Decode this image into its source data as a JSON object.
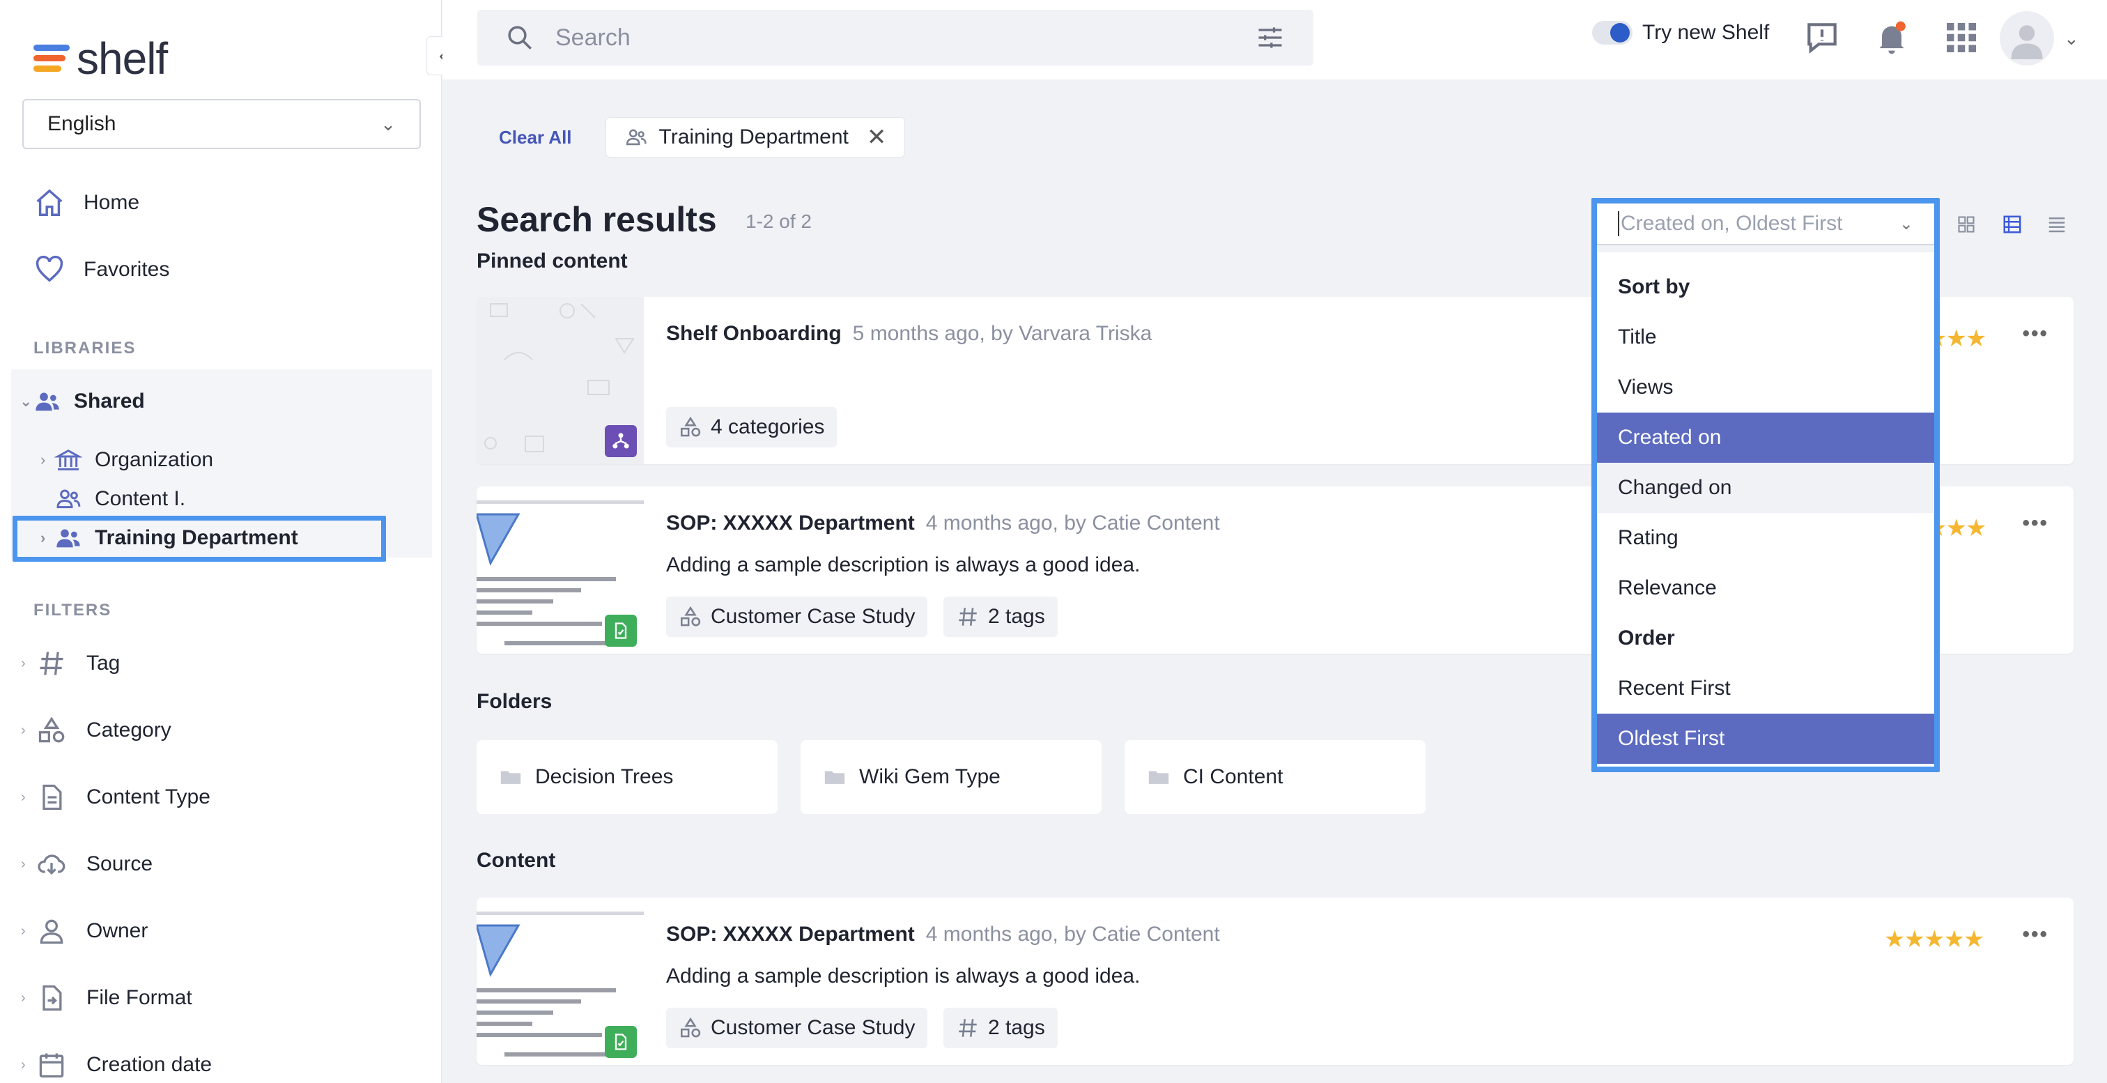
{
  "app": {
    "brand": "shelf",
    "colors": {
      "accent": "#5c6bc0",
      "highlight": "#4b95ee",
      "star": "#f5b730"
    }
  },
  "sidebar": {
    "language": "English",
    "nav": [
      {
        "label": "Home",
        "icon": "home-icon"
      },
      {
        "label": "Favorites",
        "icon": "heart-icon"
      }
    ],
    "libraries_label": "LIBRARIES",
    "libraries": {
      "shared": "Shared",
      "children": [
        "Organization",
        "Content I.",
        "Training Department"
      ]
    },
    "filters_label": "FILTERS",
    "filters": [
      "Tag",
      "Category",
      "Content Type",
      "Source",
      "Owner",
      "File Format",
      "Creation date"
    ]
  },
  "topbar": {
    "search_placeholder": "Search",
    "try_new": "Try new Shelf"
  },
  "main": {
    "clear_all": "Clear All",
    "active_filter": "Training Department",
    "results_title": "Search results",
    "results_count": "1-2 of 2",
    "pinned_label": "Pinned content",
    "folders_label": "Folders",
    "content_label": "Content",
    "pinned": [
      {
        "title": "Shelf Onboarding",
        "meta": "5 months ago, by Varvara Triska",
        "desc": "",
        "tags": [
          "4 categories"
        ]
      },
      {
        "title": "SOP: XXXXX Department",
        "meta": "4 months ago, by Catie Content",
        "desc": "Adding a sample description is always a good idea.",
        "tags": [
          "Customer Case Study",
          "2 tags"
        ]
      }
    ],
    "folders": [
      "Decision Trees",
      "Wiki Gem Type",
      "CI Content"
    ],
    "content": [
      {
        "title": "SOP: XXXXX Department",
        "meta": "4 months ago, by Catie Content",
        "desc": "Adding a sample description is always a good idea.",
        "tags": [
          "Customer Case Study",
          "2 tags"
        ],
        "rating": 5
      }
    ]
  },
  "sort": {
    "value": "Created on, Oldest First",
    "sort_by_label": "Sort by",
    "sort_options": [
      "Title",
      "Views",
      "Created on",
      "Changed on",
      "Rating",
      "Relevance"
    ],
    "selected_sort": "Created on",
    "order_label": "Order",
    "order_options": [
      "Recent First",
      "Oldest First"
    ],
    "selected_order": "Oldest First"
  }
}
